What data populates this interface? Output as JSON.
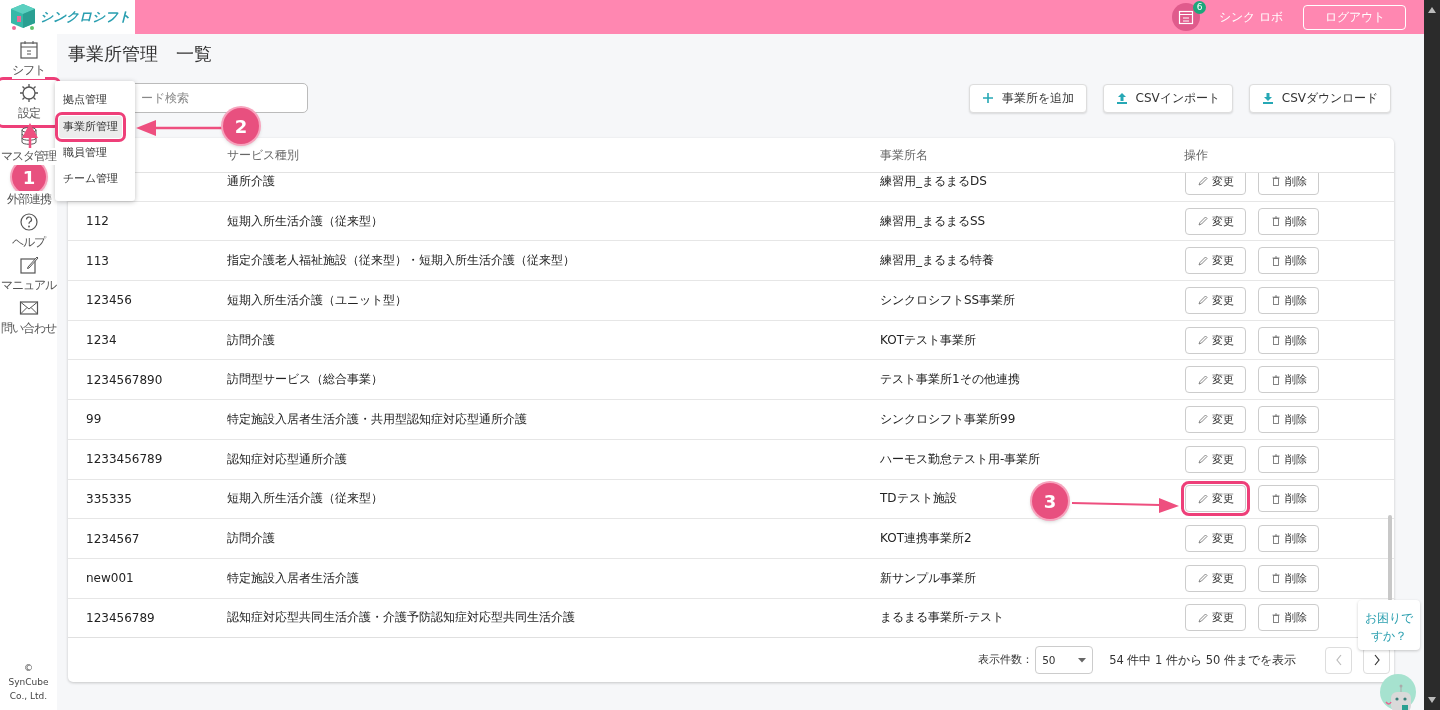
{
  "header": {
    "logo": "シンクロシフト",
    "notification_count": "6",
    "user": "シンク ロボ",
    "logout": "ログアウト"
  },
  "sidebar": {
    "items": [
      {
        "label": "シフト",
        "highlighted": false
      },
      {
        "label": "設定",
        "highlighted": true
      },
      {
        "label": "マスタ管理",
        "highlighted": false
      },
      {
        "label": "外部連携",
        "highlighted": false
      },
      {
        "label": "ヘルプ",
        "highlighted": false
      },
      {
        "label": "マニュアル",
        "highlighted": false
      },
      {
        "label": "問い合わせ",
        "highlighted": false
      }
    ],
    "footer": "© SynCube Co., Ltd."
  },
  "settings_menu": {
    "items": [
      {
        "label": "拠点管理",
        "selected": false,
        "highlighted": false
      },
      {
        "label": "事業所管理",
        "selected": true,
        "highlighted": true
      },
      {
        "label": "職員管理",
        "selected": false,
        "highlighted": false
      },
      {
        "label": "チーム管理",
        "selected": false,
        "highlighted": false
      }
    ]
  },
  "page": {
    "title": "事業所管理　一覧",
    "search": {
      "placeholder": "ード検索"
    },
    "buttons": [
      {
        "label": "事業所を追加"
      },
      {
        "label": "CSVインポート"
      },
      {
        "label": "CSVダウンロード"
      }
    ]
  },
  "table": {
    "columns": [
      {
        "label": "サービス種別"
      },
      {
        "label": "事業所名"
      },
      {
        "label": "操作"
      }
    ],
    "rows": [
      {
        "service": "通所介護",
        "office": "練習用_まるまるDS",
        "edit": "変更",
        "delete": "削除",
        "edit_highlighted": false
      },
      {
        "code": "112",
        "service": "短期入所生活介護（従来型）",
        "office": "練習用_まるまるSS",
        "edit": "変更",
        "delete": "削除",
        "edit_highlighted": false
      },
      {
        "code": "113",
        "service": "指定介護老人福祉施設（従来型）・短期入所生活介護（従来型）",
        "office": "練習用_まるまる特養",
        "edit": "変更",
        "delete": "削除",
        "edit_highlighted": false
      },
      {
        "code": "123456",
        "service": "短期入所生活介護（ユニット型）",
        "office": "シンクロシフトSS事業所",
        "edit": "変更",
        "delete": "削除",
        "edit_highlighted": false
      },
      {
        "code": "1234",
        "service": "訪問介護",
        "office": "KOTテスト事業所",
        "edit": "変更",
        "delete": "削除",
        "edit_highlighted": false
      },
      {
        "code": "1234567890",
        "service": "訪問型サービス（総合事業）",
        "office": "テスト事業所1その他連携",
        "edit": "変更",
        "delete": "削除",
        "edit_highlighted": false
      },
      {
        "code": "99",
        "service": "特定施設入居者生活介護・共用型認知症対応型通所介護",
        "office": "シンクロシフト事業所99",
        "edit": "変更",
        "delete": "削除",
        "edit_highlighted": false
      },
      {
        "code": "1233456789",
        "service": "認知症対応型通所介護",
        "office": "ハーモス勤怠テスト用-事業所",
        "edit": "変更",
        "delete": "削除",
        "edit_highlighted": false
      },
      {
        "code": "335335",
        "service": "短期入所生活介護（従来型）",
        "office": "TDテスト施設",
        "edit": "変更",
        "delete": "削除",
        "edit_highlighted": true
      },
      {
        "code": "1234567",
        "service": "訪問介護",
        "office": "KOT連携事業所2",
        "edit": "変更",
        "delete": "削除",
        "edit_highlighted": false
      },
      {
        "code": "new001",
        "service": "特定施設入居者生活介護",
        "office": "新サンプル事業所",
        "edit": "変更",
        "delete": "削除",
        "edit_highlighted": false
      },
      {
        "code": "123456789",
        "service": "認知症対応型共同生活介護・介護予防認知症対応型共同生活介護",
        "office": "まるまる事業所-テスト",
        "edit": "変更",
        "delete": "削除",
        "edit_highlighted": false
      }
    ],
    "footer": {
      "per_page_label": "表示件数：",
      "per_page": "50",
      "summary": "54 件中 1 件から 50 件までを表示"
    }
  },
  "help": {
    "bubble": "お困りですか？"
  },
  "annotations": [
    {
      "label": "1"
    },
    {
      "label": "2"
    },
    {
      "label": "3"
    }
  ]
}
